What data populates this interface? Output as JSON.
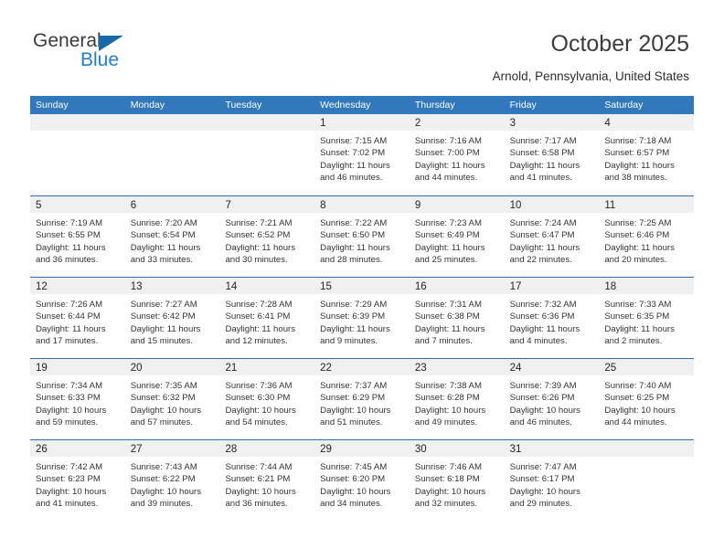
{
  "logo": {
    "word_top": "General",
    "word_bottom": "Blue",
    "triangle_icon": "triangle-icon",
    "blue": "#1f7fd4",
    "triangle_color": "#1769aa"
  },
  "header": {
    "title": "October 2025",
    "subtitle": "Arnold, Pennsylvania, United States"
  },
  "colors": {
    "header_band": "#3179bc",
    "row_divider": "#2f6fb0",
    "day_number_band": "#f0f0f0",
    "text": "#333333"
  },
  "weekdays": [
    "Sunday",
    "Monday",
    "Tuesday",
    "Wednesday",
    "Thursday",
    "Friday",
    "Saturday"
  ],
  "labels": {
    "sunrise_prefix": "Sunrise: ",
    "sunset_prefix": "Sunset: ",
    "daylight_prefix": "Daylight: "
  },
  "weeks": [
    [
      {
        "day": "",
        "empty": true
      },
      {
        "day": "",
        "empty": true
      },
      {
        "day": "",
        "empty": true
      },
      {
        "day": "1",
        "sunrise": "Sunrise: 7:15 AM",
        "sunset": "Sunset: 7:02 PM",
        "daylight": "Daylight: 11 hours and 46 minutes."
      },
      {
        "day": "2",
        "sunrise": "Sunrise: 7:16 AM",
        "sunset": "Sunset: 7:00 PM",
        "daylight": "Daylight: 11 hours and 44 minutes."
      },
      {
        "day": "3",
        "sunrise": "Sunrise: 7:17 AM",
        "sunset": "Sunset: 6:58 PM",
        "daylight": "Daylight: 11 hours and 41 minutes."
      },
      {
        "day": "4",
        "sunrise": "Sunrise: 7:18 AM",
        "sunset": "Sunset: 6:57 PM",
        "daylight": "Daylight: 11 hours and 38 minutes."
      }
    ],
    [
      {
        "day": "5",
        "sunrise": "Sunrise: 7:19 AM",
        "sunset": "Sunset: 6:55 PM",
        "daylight": "Daylight: 11 hours and 36 minutes."
      },
      {
        "day": "6",
        "sunrise": "Sunrise: 7:20 AM",
        "sunset": "Sunset: 6:54 PM",
        "daylight": "Daylight: 11 hours and 33 minutes."
      },
      {
        "day": "7",
        "sunrise": "Sunrise: 7:21 AM",
        "sunset": "Sunset: 6:52 PM",
        "daylight": "Daylight: 11 hours and 30 minutes."
      },
      {
        "day": "8",
        "sunrise": "Sunrise: 7:22 AM",
        "sunset": "Sunset: 6:50 PM",
        "daylight": "Daylight: 11 hours and 28 minutes."
      },
      {
        "day": "9",
        "sunrise": "Sunrise: 7:23 AM",
        "sunset": "Sunset: 6:49 PM",
        "daylight": "Daylight: 11 hours and 25 minutes."
      },
      {
        "day": "10",
        "sunrise": "Sunrise: 7:24 AM",
        "sunset": "Sunset: 6:47 PM",
        "daylight": "Daylight: 11 hours and 22 minutes."
      },
      {
        "day": "11",
        "sunrise": "Sunrise: 7:25 AM",
        "sunset": "Sunset: 6:46 PM",
        "daylight": "Daylight: 11 hours and 20 minutes."
      }
    ],
    [
      {
        "day": "12",
        "sunrise": "Sunrise: 7:26 AM",
        "sunset": "Sunset: 6:44 PM",
        "daylight": "Daylight: 11 hours and 17 minutes."
      },
      {
        "day": "13",
        "sunrise": "Sunrise: 7:27 AM",
        "sunset": "Sunset: 6:42 PM",
        "daylight": "Daylight: 11 hours and 15 minutes."
      },
      {
        "day": "14",
        "sunrise": "Sunrise: 7:28 AM",
        "sunset": "Sunset: 6:41 PM",
        "daylight": "Daylight: 11 hours and 12 minutes."
      },
      {
        "day": "15",
        "sunrise": "Sunrise: 7:29 AM",
        "sunset": "Sunset: 6:39 PM",
        "daylight": "Daylight: 11 hours and 9 minutes."
      },
      {
        "day": "16",
        "sunrise": "Sunrise: 7:31 AM",
        "sunset": "Sunset: 6:38 PM",
        "daylight": "Daylight: 11 hours and 7 minutes."
      },
      {
        "day": "17",
        "sunrise": "Sunrise: 7:32 AM",
        "sunset": "Sunset: 6:36 PM",
        "daylight": "Daylight: 11 hours and 4 minutes."
      },
      {
        "day": "18",
        "sunrise": "Sunrise: 7:33 AM",
        "sunset": "Sunset: 6:35 PM",
        "daylight": "Daylight: 11 hours and 2 minutes."
      }
    ],
    [
      {
        "day": "19",
        "sunrise": "Sunrise: 7:34 AM",
        "sunset": "Sunset: 6:33 PM",
        "daylight": "Daylight: 10 hours and 59 minutes."
      },
      {
        "day": "20",
        "sunrise": "Sunrise: 7:35 AM",
        "sunset": "Sunset: 6:32 PM",
        "daylight": "Daylight: 10 hours and 57 minutes."
      },
      {
        "day": "21",
        "sunrise": "Sunrise: 7:36 AM",
        "sunset": "Sunset: 6:30 PM",
        "daylight": "Daylight: 10 hours and 54 minutes."
      },
      {
        "day": "22",
        "sunrise": "Sunrise: 7:37 AM",
        "sunset": "Sunset: 6:29 PM",
        "daylight": "Daylight: 10 hours and 51 minutes."
      },
      {
        "day": "23",
        "sunrise": "Sunrise: 7:38 AM",
        "sunset": "Sunset: 6:28 PM",
        "daylight": "Daylight: 10 hours and 49 minutes."
      },
      {
        "day": "24",
        "sunrise": "Sunrise: 7:39 AM",
        "sunset": "Sunset: 6:26 PM",
        "daylight": "Daylight: 10 hours and 46 minutes."
      },
      {
        "day": "25",
        "sunrise": "Sunrise: 7:40 AM",
        "sunset": "Sunset: 6:25 PM",
        "daylight": "Daylight: 10 hours and 44 minutes."
      }
    ],
    [
      {
        "day": "26",
        "sunrise": "Sunrise: 7:42 AM",
        "sunset": "Sunset: 6:23 PM",
        "daylight": "Daylight: 10 hours and 41 minutes."
      },
      {
        "day": "27",
        "sunrise": "Sunrise: 7:43 AM",
        "sunset": "Sunset: 6:22 PM",
        "daylight": "Daylight: 10 hours and 39 minutes."
      },
      {
        "day": "28",
        "sunrise": "Sunrise: 7:44 AM",
        "sunset": "Sunset: 6:21 PM",
        "daylight": "Daylight: 10 hours and 36 minutes."
      },
      {
        "day": "29",
        "sunrise": "Sunrise: 7:45 AM",
        "sunset": "Sunset: 6:20 PM",
        "daylight": "Daylight: 10 hours and 34 minutes."
      },
      {
        "day": "30",
        "sunrise": "Sunrise: 7:46 AM",
        "sunset": "Sunset: 6:18 PM",
        "daylight": "Daylight: 10 hours and 32 minutes."
      },
      {
        "day": "31",
        "sunrise": "Sunrise: 7:47 AM",
        "sunset": "Sunset: 6:17 PM",
        "daylight": "Daylight: 10 hours and 29 minutes."
      },
      {
        "day": "",
        "empty": true
      }
    ]
  ]
}
